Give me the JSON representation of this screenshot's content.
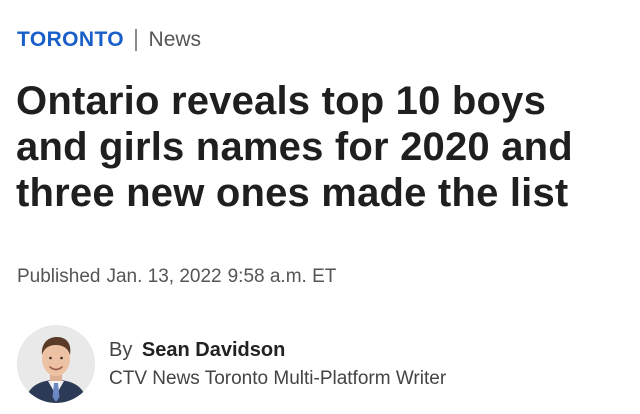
{
  "section": {
    "name": "TORONTO",
    "category": "News"
  },
  "headline": "Ontario reveals top 10 boys and girls names for 2020 and three new ones made the list",
  "published": {
    "label": "Published",
    "date": "Jan. 13, 2022",
    "time": "9:58 a.m. ET"
  },
  "byline": {
    "prefix": "By",
    "author": "Sean Davidson",
    "role": "CTV News Toronto Multi-Platform Writer",
    "avatar_icon": "author-photo"
  },
  "colors": {
    "section_accent": "#1a5fc9",
    "text_primary": "#1f1f1f",
    "text_secondary": "#555555"
  }
}
